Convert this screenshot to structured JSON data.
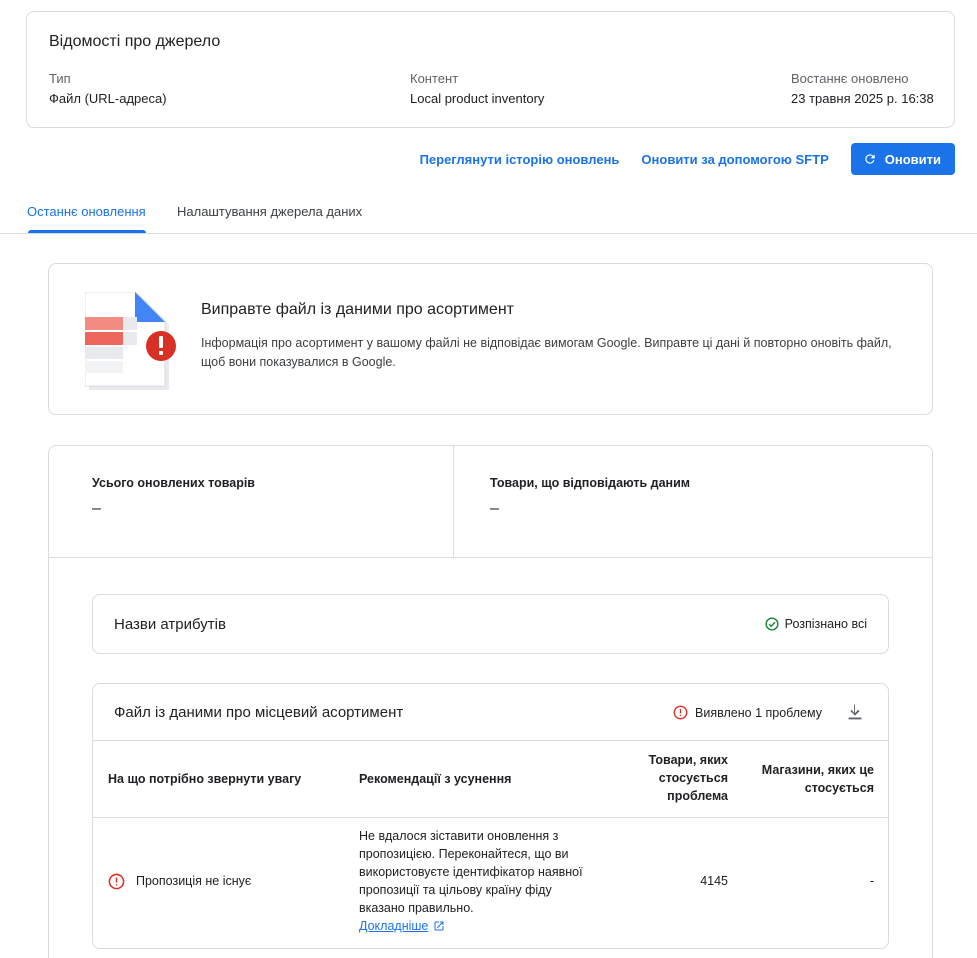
{
  "source_info": {
    "title": "Відомості про джерело",
    "type_label": "Тип",
    "type_value": "Файл (URL-адреса)",
    "content_label": "Контент",
    "content_value": "Local product inventory",
    "updated_label": "Востаннє оновлено",
    "updated_value": "23 травня 2025 р. 16:38"
  },
  "actions": {
    "history_link": "Переглянути історію оновлень",
    "sftp_link": "Оновити за допомогою SFTP",
    "refresh_button": "Оновити"
  },
  "tabs": [
    {
      "label": "Останнє оновлення",
      "active": true
    },
    {
      "label": "Налаштування джерела даних",
      "active": false
    }
  ],
  "alert": {
    "title": "Виправте файл із даними про асортимент",
    "text": "Інформація про асортимент у вашому файлі не відповідає вимогам Google. Виправте ці дані й повторно оновіть файл, щоб вони показувалися в Google."
  },
  "stats": {
    "total_label": "Усього оновлених товарів",
    "total_value": "–",
    "matched_label": "Товари, що відповідають даним",
    "matched_value": "–"
  },
  "attributes": {
    "title": "Назви атрибутів",
    "status": "Розпізнано всі"
  },
  "feed": {
    "title": "Файл із даними про місцевий асортимент",
    "status": "Виявлено 1 проблему",
    "columns": [
      "На що потрібно звернути увагу",
      "Рекомендації з усунення",
      "Товари, яких стосується проблема",
      "Магазини, яких це стосується"
    ],
    "rows": [
      {
        "issue": "Пропозиція не існує",
        "recommendation": "Не вдалося зіставити оновлення з пропозицією. Переконайтеся, що ви використовуєте ідентифікатор наявної пропозиції та цільову країну фіду вказано правильно.",
        "learn_more": "Докладніше",
        "products": "4145",
        "stores": "-"
      }
    ]
  },
  "colors": {
    "accent": "#1a73e8",
    "error": "#d93025",
    "success": "#188038",
    "border": "#dadce0"
  }
}
